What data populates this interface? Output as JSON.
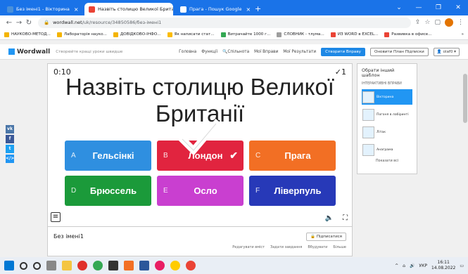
{
  "browser": {
    "tabs": [
      {
        "label": "Без імені1 - Вікторина",
        "active": false,
        "icon_color": "#4a90d9"
      },
      {
        "label": "Назвіть столицю Великої Брита",
        "active": true,
        "icon_color": "#ea4335"
      },
      {
        "label": "Прага - Пошук Google",
        "active": false,
        "icon_color": "#ffffff"
      }
    ],
    "new_tab": "+",
    "url_host": "wordwall.net",
    "url_path": "/uk/resource/34850586/без-імені1",
    "bookmarks": [
      {
        "label": "НАУКОВО-МЕТОД...",
        "color": "#f4b400"
      },
      {
        "label": "Лабораторія науко...",
        "color": "#f4b400"
      },
      {
        "label": "ДОВІДКОВО-ІНФО...",
        "color": "#f4b400"
      },
      {
        "label": "Як написати стат...",
        "color": "#fbbc04"
      },
      {
        "label": "Витрачайте 1000 г...",
        "color": "#34a853"
      },
      {
        "label": "СЛОВНИК - тлума...",
        "color": "#9e9e9e"
      },
      {
        "label": "ИЗ WORD в EXCEL...",
        "color": "#ea4335"
      },
      {
        "label": "Развивка в офисе...",
        "color": "#ea4335"
      }
    ],
    "bookmarks_more": "»"
  },
  "wordwall": {
    "logo": "Wordwall",
    "tagline": "Створюйте кращі уроки швидше",
    "menu": [
      "Головна",
      "Функції",
      "Спільнота",
      "Мої Вправи",
      "Мої Результати"
    ],
    "create_button": "Створити Вправу",
    "plan_button": "Оновити План Підписки",
    "user": "olaf0"
  },
  "game": {
    "timer": "0:10",
    "score": "✓1",
    "question": "Назвіть столицю Великої Британії",
    "answers": [
      {
        "letter": "A",
        "text": "Гельсінкі",
        "color": "#2f8fe0"
      },
      {
        "letter": "B",
        "text": "Лондон",
        "color": "#e1243f",
        "correct": true
      },
      {
        "letter": "C",
        "text": "Прага",
        "color": "#f26f24"
      },
      {
        "letter": "D",
        "text": "Брюссель",
        "color": "#1b9a3a"
      },
      {
        "letter": "E",
        "text": "Осло",
        "color": "#c93fd0"
      },
      {
        "letter": "F",
        "text": "Ліверпуль",
        "color": "#2739b8"
      }
    ]
  },
  "activity": {
    "title": "Без імені1",
    "subscribe": "Підписатися",
    "actions": [
      "Редагувати вміст",
      "Задати завдання",
      "Вбудувати",
      "Більше"
    ]
  },
  "templates": {
    "title": "Обрати інший шаблон",
    "subtitle": "ІНТЕРАКТИВНІ ВПРАВИ",
    "items": [
      "Вікторина",
      "Погоня в лабіринті",
      "Літак",
      "Анаграма"
    ],
    "show_all": "Показати всі"
  },
  "social": [
    {
      "label": "vk",
      "color": "#4a76a8"
    },
    {
      "label": "f",
      "color": "#3b5998"
    },
    {
      "label": "t",
      "color": "#1da1f2"
    },
    {
      "label": "</>",
      "color": "#2196f3"
    }
  ],
  "taskbar": {
    "lang": "УКР",
    "time": "16:11",
    "date": "14.08.2022"
  }
}
